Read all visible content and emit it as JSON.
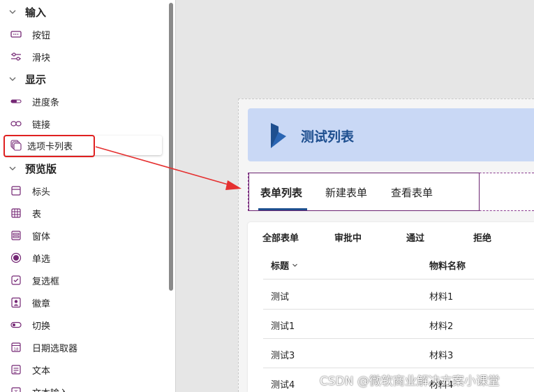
{
  "sidebar": {
    "sections": [
      {
        "label": "输入",
        "icon": "chevron-down-icon"
      },
      {
        "label": "显示",
        "icon": "chevron-down-icon"
      },
      {
        "label": "预览版",
        "icon": "chevron-down-icon"
      }
    ],
    "items": [
      {
        "label": "按钮",
        "icon": "button-icon"
      },
      {
        "label": "滑块",
        "icon": "slider-icon"
      },
      {
        "label": "进度条",
        "icon": "progress-bar-icon"
      },
      {
        "label": "链接",
        "icon": "link-icon"
      },
      {
        "label": "选项卡列表",
        "icon": "tab-list-icon"
      },
      {
        "label": "标头",
        "icon": "header-icon"
      },
      {
        "label": "表",
        "icon": "table-icon"
      },
      {
        "label": "窗体",
        "icon": "form-icon"
      },
      {
        "label": "单选",
        "icon": "radio-icon"
      },
      {
        "label": "复选框",
        "icon": "checkbox-icon"
      },
      {
        "label": "徽章",
        "icon": "badge-icon"
      },
      {
        "label": "切换",
        "icon": "toggle-icon"
      },
      {
        "label": "日期选取器",
        "icon": "date-picker-icon"
      },
      {
        "label": "文本",
        "icon": "text-icon"
      },
      {
        "label": "文本输入",
        "icon": "text-input-icon"
      }
    ]
  },
  "canvas": {
    "header_title": "测试列表",
    "tabs": [
      {
        "label": "表单列表",
        "active": true
      },
      {
        "label": "新建表单",
        "active": false
      },
      {
        "label": "查看表单",
        "active": false
      }
    ],
    "filters": [
      "全部表单",
      "审批中",
      "通过",
      "拒绝"
    ],
    "columns": [
      "标题",
      "物料名称"
    ],
    "rows": [
      [
        "测试",
        "材料1"
      ],
      [
        "测试1",
        "材料2"
      ],
      [
        "测试3",
        "材料3"
      ],
      [
        "测试4",
        "材料4"
      ]
    ]
  },
  "watermark": "CSDN @微软商业解决方案小课堂",
  "colors": {
    "accent": "#742774",
    "header_bg": "#c9d8f5",
    "header_text": "#1e4f8f",
    "highlight": "#e02020"
  }
}
